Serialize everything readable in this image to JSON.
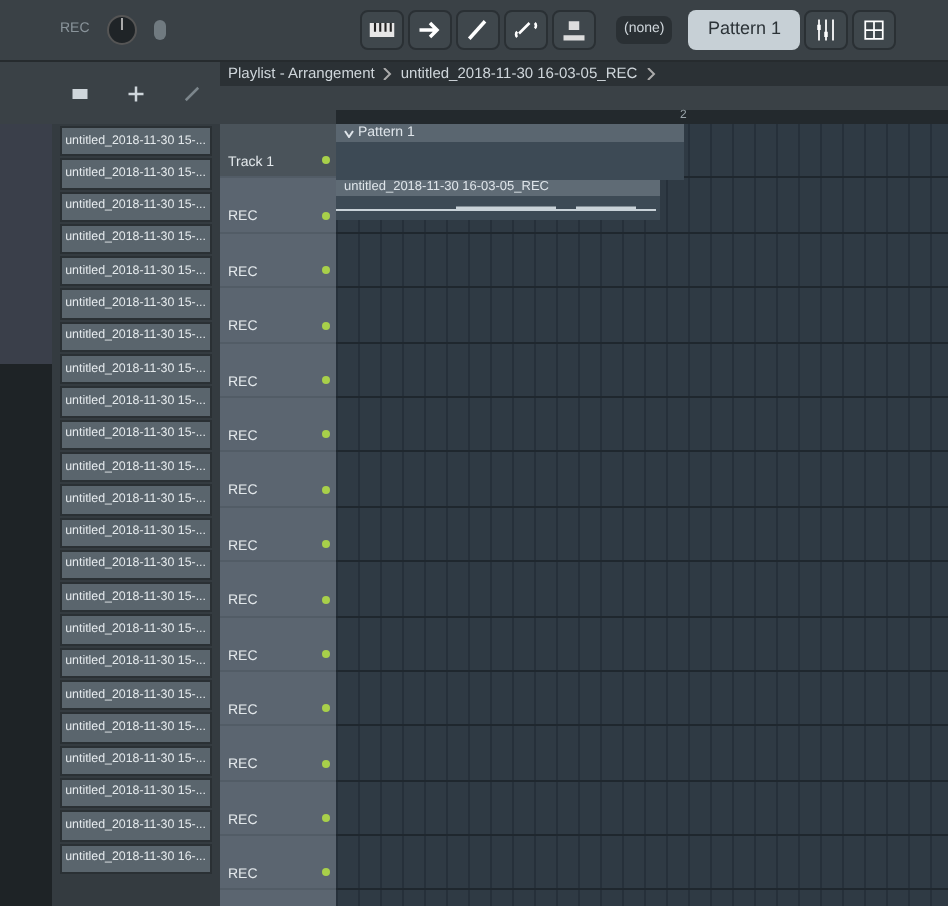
{
  "toolbar": {
    "rec_label": "REC",
    "pattern_dropdown": "(none)",
    "pattern_name": "Pattern 1"
  },
  "playlist": {
    "title": "Playlist - Arrangement",
    "project": "untitled_2018-11-30 16-03-05_REC",
    "ruler_mark": "2",
    "tracks": [
      {
        "name": "Track 1",
        "clip": {
          "kind": "pattern",
          "label": "Pattern 1"
        }
      },
      {
        "name": "REC",
        "clip": {
          "kind": "audio",
          "label": "untitled_2018-11-30 16-03-05_REC"
        }
      },
      {
        "name": "REC"
      },
      {
        "name": "REC"
      },
      {
        "name": "REC"
      },
      {
        "name": "REC"
      },
      {
        "name": "REC"
      },
      {
        "name": "REC"
      },
      {
        "name": "REC"
      },
      {
        "name": "REC"
      },
      {
        "name": "REC"
      },
      {
        "name": "REC"
      },
      {
        "name": "REC"
      },
      {
        "name": "REC"
      }
    ]
  },
  "clip_list": [
    "untitled_2018-11-30 15-...",
    "untitled_2018-11-30 15-...",
    "untitled_2018-11-30 15-...",
    "untitled_2018-11-30 15-...",
    "untitled_2018-11-30 15-...",
    "untitled_2018-11-30 15-...",
    "untitled_2018-11-30 15-...",
    "untitled_2018-11-30 15-...",
    "untitled_2018-11-30 15-...",
    "untitled_2018-11-30 15-...",
    "untitled_2018-11-30 15-...",
    "untitled_2018-11-30 15-...",
    "untitled_2018-11-30 15-...",
    "untitled_2018-11-30 15-...",
    "untitled_2018-11-30 15-...",
    "untitled_2018-11-30 15-...",
    "untitled_2018-11-30 15-...",
    "untitled_2018-11-30 15-...",
    "untitled_2018-11-30 15-...",
    "untitled_2018-11-30 15-...",
    "untitled_2018-11-30 15-...",
    "untitled_2018-11-30 15-...",
    "untitled_2018-11-30 16-..."
  ]
}
